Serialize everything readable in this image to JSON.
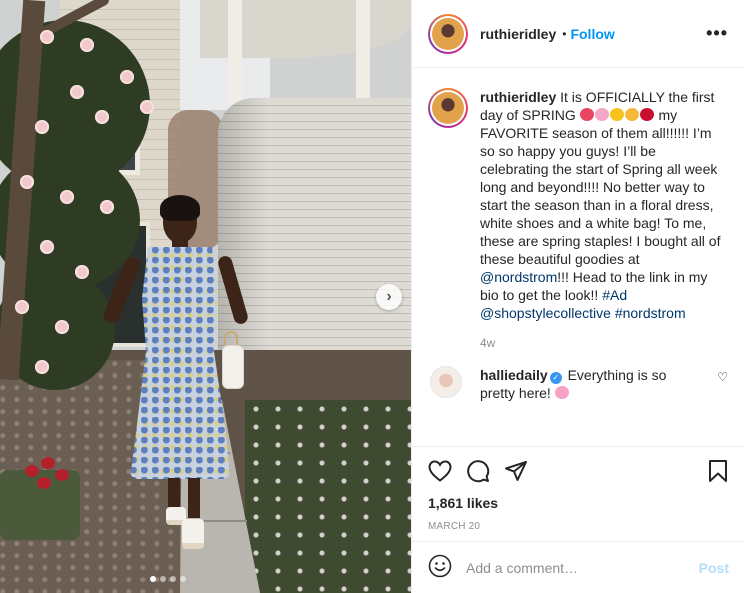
{
  "post": {
    "username": "ruthieridley",
    "follow_label": "Follow",
    "bullet": "•",
    "more_label": "•••",
    "next_arrow": "›",
    "carousel_dots": 4,
    "carousel_active": 1
  },
  "caption": {
    "username": "ruthieridley",
    "text_1": "It is OFFICIALLY the first day of SPRING",
    "text_2": "my FAVORITE season of them all!!!!!! I’m so so happy you guys! I’ll be celebrating the start of Spring all week long and beyond!!!! No better way to start the season than in a floral dress, white shoes and a white bag! To me, these are spring staples! I bought all of these beautiful goodies at",
    "mention": "@nordstrom",
    "text_3": "!!! Head to the link in my bio to get the look!!",
    "tag_ad": "#Ad",
    "mention_2": "@shopstylecollective",
    "tag_nordstrom": "#nordstrom",
    "time": "4w",
    "emoji_colors": [
      "#e8475f",
      "#f3a6c8",
      "#f7c21e",
      "#f6b93b",
      "#c8102e"
    ]
  },
  "comment": {
    "username": "halliedaily",
    "verified_mark": "✓",
    "text": "Everything is so pretty here!",
    "emoji_color": "#f7a1c4",
    "like_icon": "♡"
  },
  "engagement": {
    "likes": "1,861 likes",
    "date": "MARCH 20"
  },
  "add_comment": {
    "placeholder": "Add a comment…",
    "post_label": "Post"
  },
  "colors": {
    "link": "#00376b",
    "follow": "#0095f6",
    "muted": "#8e8e8e",
    "post_disabled": "#b2dffc"
  }
}
